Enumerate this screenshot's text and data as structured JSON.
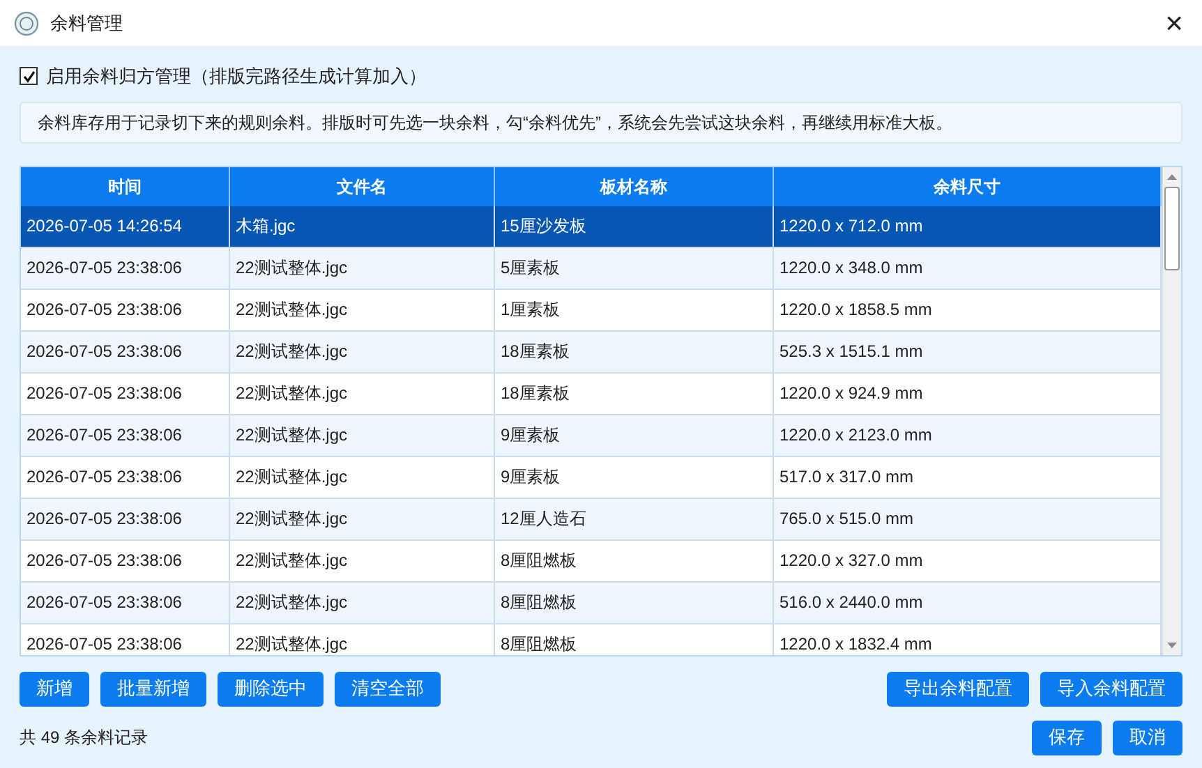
{
  "window": {
    "title": "余料管理",
    "close": "×"
  },
  "enable": {
    "label": "启用余料归方管理（排版完路径生成计算加入）",
    "checked": true
  },
  "info": "余料库存用于记录切下来的规则余料。排版时可先选一块余料，勾“余料优先”，系统会先尝试这块余料，再继续用标准大板。",
  "table": {
    "columns": [
      "时间",
      "文件名",
      "板材名称",
      "余料尺寸"
    ],
    "rows": [
      {
        "cells": [
          "2026-07-05 14:26:54",
          "木箱.jgc",
          "15厘沙发板",
          "1220.0 x 712.0 mm"
        ],
        "selected": true
      },
      {
        "cells": [
          "2026-07-05 23:38:06",
          "22测试整体.jgc",
          "5厘素板",
          "1220.0 x 348.0 mm"
        ],
        "selected": false
      },
      {
        "cells": [
          "2026-07-05 23:38:06",
          "22测试整体.jgc",
          "1厘素板",
          "1220.0 x 1858.5 mm"
        ],
        "selected": false
      },
      {
        "cells": [
          "2026-07-05 23:38:06",
          "22测试整体.jgc",
          "18厘素板",
          "525.3 x 1515.1 mm"
        ],
        "selected": false
      },
      {
        "cells": [
          "2026-07-05 23:38:06",
          "22测试整体.jgc",
          "18厘素板",
          "1220.0 x 924.9 mm"
        ],
        "selected": false
      },
      {
        "cells": [
          "2026-07-05 23:38:06",
          "22测试整体.jgc",
          "9厘素板",
          "1220.0 x 2123.0 mm"
        ],
        "selected": false
      },
      {
        "cells": [
          "2026-07-05 23:38:06",
          "22测试整体.jgc",
          "9厘素板",
          "517.0 x 317.0 mm"
        ],
        "selected": false
      },
      {
        "cells": [
          "2026-07-05 23:38:06",
          "22测试整体.jgc",
          "12厘人造石",
          "765.0 x 515.0 mm"
        ],
        "selected": false
      },
      {
        "cells": [
          "2026-07-05 23:38:06",
          "22测试整体.jgc",
          "8厘阻燃板",
          "1220.0 x 327.0 mm"
        ],
        "selected": false
      },
      {
        "cells": [
          "2026-07-05 23:38:06",
          "22测试整体.jgc",
          "8厘阻燃板",
          "516.0 x 2440.0 mm"
        ],
        "selected": false
      },
      {
        "cells": [
          "2026-07-05 23:38:06",
          "22测试整体.jgc",
          "8厘阻燃板",
          "1220.0 x 1832.4 mm"
        ],
        "selected": false
      }
    ]
  },
  "left_buttons": [
    "新增",
    "批量新增",
    "删除选中",
    "清空全部"
  ],
  "right_buttons": [
    "导出余料配置",
    "导入余料配置"
  ],
  "status": "共 49 条余料记录",
  "dialog_buttons": [
    "保存",
    "取消"
  ]
}
